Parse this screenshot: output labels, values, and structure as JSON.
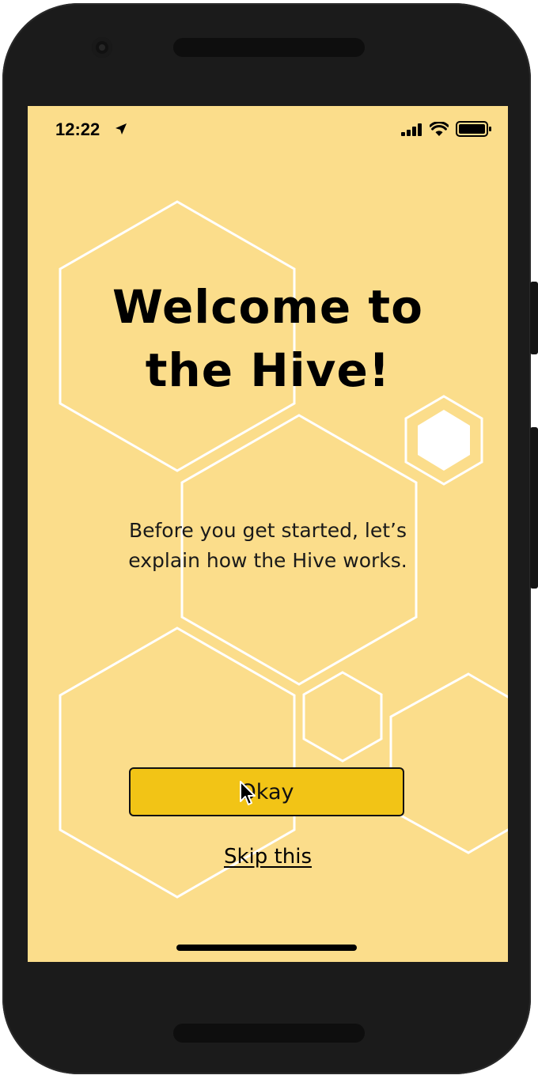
{
  "status_bar": {
    "time": "12:22",
    "icons": [
      "location-arrow-icon",
      "cellular-signal-icon",
      "wifi-icon",
      "battery-icon"
    ]
  },
  "onboarding": {
    "title_line1": "Welcome to",
    "title_line2": "the Hive!",
    "subtitle_line1": "Before you get started, let’s",
    "subtitle_line2": "explain how the Hive works.",
    "okay_label": "Okay",
    "skip_label": "Skip this"
  },
  "colors": {
    "background": "#fbdd8b",
    "button": "#f2c416",
    "hex_outline": "#ffffff",
    "text": "#000000"
  }
}
